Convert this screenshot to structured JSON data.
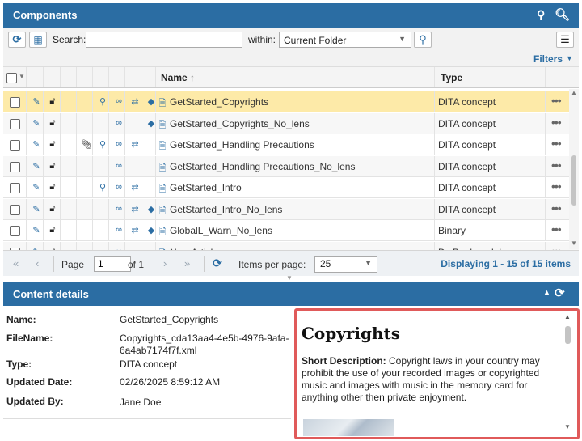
{
  "components_header": {
    "title": "Components"
  },
  "toolbar": {
    "search_label": "Search:",
    "search_value": "",
    "within_label": "within:",
    "within_value": "Current Folder",
    "filters_label": "Filters"
  },
  "columns": {
    "name": "Name",
    "type": "Type"
  },
  "rows": [
    {
      "name": "GetStarted_Copyrights",
      "type": "DITA concept"
    },
    {
      "name": "GetStarted_Copyrights_No_lens",
      "type": "DITA concept"
    },
    {
      "name": "GetStarted_Handling Precautions",
      "type": "DITA concept"
    },
    {
      "name": "GetStarted_Handling Precautions_No_lens",
      "type": "DITA concept"
    },
    {
      "name": "GetStarted_Intro",
      "type": "DITA concept"
    },
    {
      "name": "GetStarted_Intro_No_lens",
      "type": "DITA concept"
    },
    {
      "name": "GlobalL_Warn_No_lens",
      "type": "Binary"
    },
    {
      "name": "New Article",
      "type": "Dv Bookmodule"
    }
  ],
  "pager": {
    "page_label": "Page",
    "page_value": "1",
    "of_label": "of 1",
    "items_per_page_label": "Items per page:",
    "items_per_page_value": "25",
    "displaying": "Displaying 1 - 15 of 15 items"
  },
  "details": {
    "title": "Content details",
    "name_label": "Name:",
    "name_value": "GetStarted_Copyrights",
    "filename_label": "FileName:",
    "filename_value_line1": "Copyrights_cda13aa4-4e5b-4976-9afa-",
    "filename_value_line2": "6a4ab7174f7f.xml",
    "type_label": "Type:",
    "type_value": "DITA concept",
    "updated_date_label": "Updated Date:",
    "updated_date_value": "02/26/2025 8:59:12 AM",
    "updated_by_label": "Updated By:",
    "updated_by_value": "Jane Doe"
  },
  "preview": {
    "heading": "Copyrights",
    "short_desc_label": "Short Description:",
    "short_desc_text": " Copyright laws in your country may prohibit the use of your recorded images or copyrighted music and images with music in the memory card for anything other then private enjoyment."
  },
  "colors": {
    "header_blue": "#2b6da3",
    "selected_row": "#fdeaa8",
    "highlight_border": "#e05a5a"
  }
}
